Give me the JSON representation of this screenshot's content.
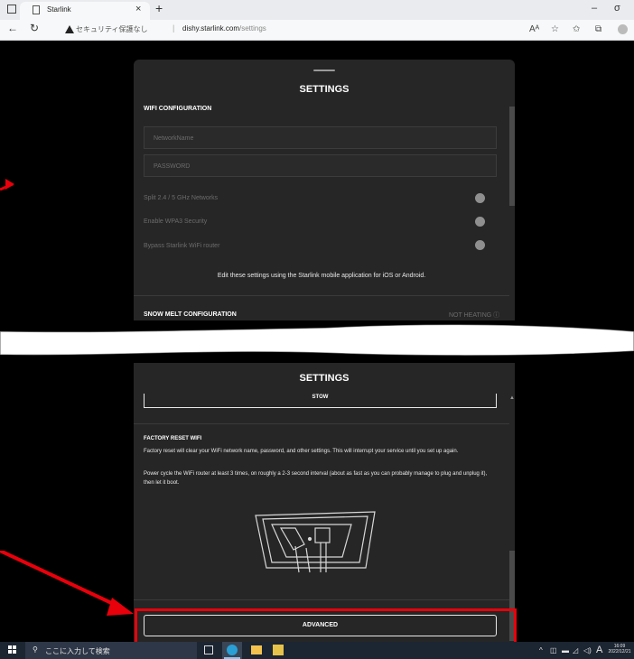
{
  "browser": {
    "tab_title": "Starlink",
    "security_warning": "セキュリティ保護なし",
    "url_host": "dishy.starlink.com",
    "url_path": "/settings",
    "window_controls": [
      "–",
      "σ"
    ]
  },
  "settings_top": {
    "title": "SETTINGS",
    "wifi_section": "WIFI CONFIGURATION",
    "ssid_placeholder": "NetworkName",
    "password_placeholder": "PASSWORD",
    "toggles": [
      "Split 2.4 / 5 GHz Networks",
      "Enable WPA3 Security",
      "Bypass Starlink WiFi router"
    ],
    "mobile_note": "Edit these settings using the Starlink mobile application for iOS or Android.",
    "snow_melt": "SNOW MELT CONFIGURATION",
    "heating_status": "NOT HEATING ⓘ"
  },
  "settings_bottom": {
    "title": "SETTINGS",
    "stow_button": "STOW",
    "factory_title": "FACTORY RESET WIFI",
    "factory_p1": "Factory reset will clear your WiFi network name, password, and other settings. This will interrupt your service until you set up again.",
    "factory_p2": "Power cycle the WiFi router at least 3 times, on roughly a 2-3 second interval (about as fast as you can probably manage to plug and unplug it), then let it boot.",
    "advanced_button": "ADVANCED"
  },
  "taskbar": {
    "search_placeholder": "ここに入力して検索",
    "time": "16:09",
    "date": "2022/12/21",
    "ime": "A"
  },
  "colors": {
    "annotation_red": "#e8000b",
    "panel": "#262626"
  }
}
